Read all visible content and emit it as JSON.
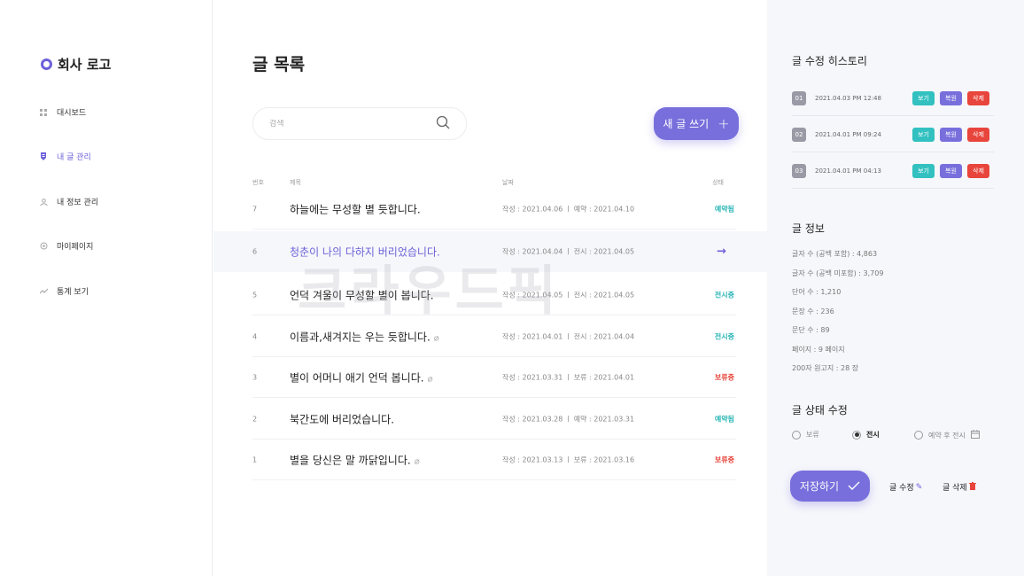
{
  "sidebar": {
    "logo": "회사 로고",
    "items": [
      {
        "label": "대시보드",
        "icon": "dashboard-icon"
      },
      {
        "label": "내 글 관리",
        "icon": "document-icon",
        "active": true
      },
      {
        "label": "내 정보 관리",
        "icon": "user-icon"
      },
      {
        "label": "마이페이지",
        "icon": "settings-icon"
      },
      {
        "label": "통계 보기",
        "icon": "chart-icon"
      }
    ]
  },
  "main": {
    "title": "글 목록",
    "search_placeholder": "검색",
    "new_post_label": "새 글 쓰기",
    "columns": {
      "num": "번호",
      "title": "제목",
      "date": "날짜",
      "status": "상태"
    },
    "rows": [
      {
        "num": "7",
        "title": "하늘에는 무성할 별 듯합니다.",
        "date": "작성 : 2021.04.06     ㅣ     예약 : 2021.04.10",
        "status": "예약됨",
        "status_color": "#2bb5b5"
      },
      {
        "num": "6",
        "title": "청춘이 나의 다하지 버리었습니다.",
        "date": "작성 : 2021.04.04     ㅣ     전시 : 2021.04.05",
        "status": "→",
        "status_color": "#6c61d9"
      },
      {
        "num": "5",
        "title": "언덕 겨울이 무성할 별이 봅니다.",
        "date": "작성 : 2021.04.05     ㅣ     전시 : 2021.04.05",
        "status": "전시중",
        "status_color": "#2bb5b5"
      },
      {
        "num": "4",
        "title": "이름과,새겨지는 우는 듯합니다.",
        "date": "작성 : 2021.04.01     ㅣ     전시 : 2021.04.04",
        "status": "전시중",
        "status_color": "#2bb5b5"
      },
      {
        "num": "3",
        "title": "별이 어머니 애기 언덕 봅니다.",
        "date": "작성 : 2021.03.31     ㅣ     보류 : 2021.04.01",
        "status": "보류중",
        "status_color": "#e8453c"
      },
      {
        "num": "2",
        "title": "북간도에 버리었습니다.",
        "date": "작성 : 2021.03.28     ㅣ     예약 : 2021.03.31",
        "status": "예약됨",
        "status_color": "#2bb5b5"
      },
      {
        "num": "1",
        "title": "별을 당신은 말 까닭입니다.",
        "date": "작성 : 2021.03.13     ㅣ     보류 : 2021.03.16",
        "status": "보류중",
        "status_color": "#e8453c"
      }
    ]
  },
  "panel": {
    "history_title": "글 수정 히스토리",
    "history": [
      {
        "num": "01",
        "time": "2021.04.03 PM 12:48"
      },
      {
        "num": "02",
        "time": "2021.04.01 PM 09:24"
      },
      {
        "num": "03",
        "time": "2021.04.01 PM 04:13"
      }
    ],
    "btn_view": "보기",
    "btn_restore": "복원",
    "btn_delete": "삭제",
    "info_title": "글 정보",
    "info": [
      "글자 수 (공백 포함) : 4,863",
      "글자 수 (공백 미포함) : 3,709",
      "단어 수 : 1,210",
      "문장 수 : 236",
      "문단 수 : 89",
      "페이지 : 9 페이지",
      "200자 원고지 : 28 장"
    ],
    "status_title": "글 상태 수정",
    "status_options": [
      "보류",
      "전시",
      "예약 후 전시"
    ],
    "selected_status": "전시",
    "save_label": "저장하기",
    "edit_label": "글 수정",
    "delete_label": "글 삭제"
  },
  "watermark": "크라우드픽"
}
